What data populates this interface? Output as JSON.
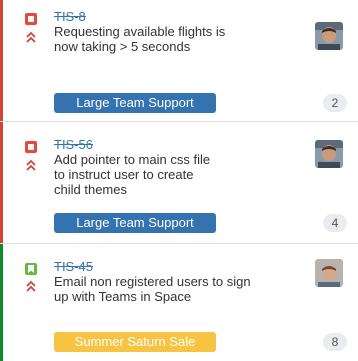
{
  "colors": {
    "bug_stripe": "#d04437",
    "story_stripe": "#14892c",
    "epic_blue": "#3572b0",
    "epic_yellow": "#f6c342",
    "key_link": "#3572b0"
  },
  "cards": [
    {
      "key": "TIS-8",
      "type_icon": "bug-icon",
      "priority_icon": "priority-highest-icon",
      "summary_lines": [
        "Requesting available flights is",
        "now taking > 5 seconds"
      ],
      "epic": "Large Team Support",
      "estimate": "2"
    },
    {
      "key": "TIS-56",
      "type_icon": "bug-icon",
      "priority_icon": "priority-highest-icon",
      "summary_lines": [
        "Add pointer to main css file",
        "to instruct user to create",
        "child themes"
      ],
      "epic": "Large Team Support",
      "estimate": "4"
    },
    {
      "key": "TIS-45",
      "type_icon": "story-icon",
      "priority_icon": "priority-highest-icon",
      "summary_lines": [
        "Email non registered users to sign",
        "up with Teams in Space"
      ],
      "epic": "Summer Saturn Sale",
      "estimate": "8"
    }
  ]
}
